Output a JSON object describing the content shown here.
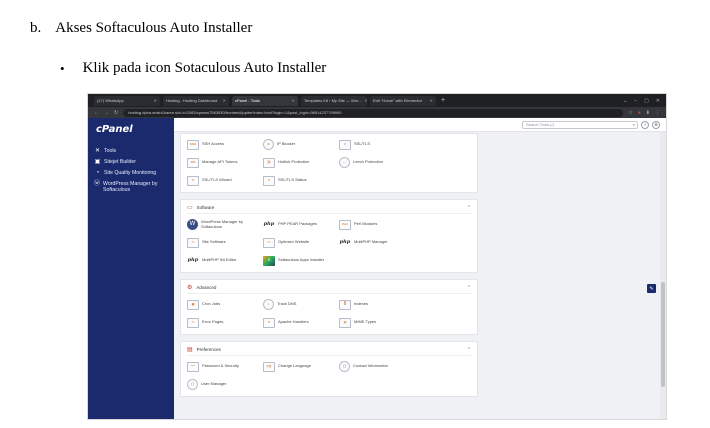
{
  "doc": {
    "heading_marker": "b.",
    "heading_text": "Akses Softaculous Auto Installer",
    "bullet_symbol": "•",
    "bullet_text": "Klik pada icon Sotaculous Auto Installer"
  },
  "browser": {
    "tabs": [
      {
        "label": "(17) WhatsApp",
        "active": false
      },
      {
        "label": "Hosting - Hosting Dashboard",
        "active": false
      },
      {
        "label": "cPanel - Tools",
        "active": true
      },
      {
        "label": "Templates Kit › My Site — Wor…",
        "active": false
      },
      {
        "label": "Edit \"Home\" with Elementor",
        "active": false
      }
    ],
    "new_tab": "+",
    "url": "hosting.dpha.smkn1karen.sch.id:2083/cpsess7563930/frontend/jupiter/index.html?login=1&post_login=98914237799990",
    "window_controls": [
      "⌄",
      "–",
      "▢",
      "✕"
    ],
    "addr_icons": [
      "☆",
      "●",
      "⬇",
      "⋮"
    ]
  },
  "cpanel": {
    "logo": "cPanel",
    "nav": [
      {
        "icon": "✕",
        "icon_name": "tools-icon",
        "label": "Tools"
      },
      {
        "icon": "▣",
        "icon_name": "sitejet-icon",
        "label": "Sitejet Builder"
      },
      {
        "icon": "◔",
        "icon_name": "monitor-icon",
        "label": "Site Quality Monitoring"
      },
      {
        "icon": "ⓦ",
        "icon_name": "wordpress-icon",
        "label": "WordPress Manager by Softaculous"
      }
    ],
    "search_placeholder": "Search Tools (/)",
    "top_icons": [
      "?",
      "⚙"
    ],
    "sections": [
      {
        "title": "",
        "collapsible": false,
        "items": [
          {
            "label": "SSH Access",
            "icon": "SSH"
          },
          {
            "label": "IP Blocker",
            "icon": "⊘"
          },
          {
            "label": "SSL/TLS",
            "icon": "≡"
          },
          {
            "label": "Manage API Tokens",
            "icon": "API"
          },
          {
            "label": "Hotlink Protection",
            "icon": "⛓"
          },
          {
            "label": "Leech Protection",
            "icon": "⋯"
          },
          {
            "label": "SSL/TLS Wizard",
            "icon": "≡"
          },
          {
            "label": "SSL/TLS Status",
            "icon": "≡"
          }
        ]
      },
      {
        "title": "Software",
        "collapsible": true,
        "items": [
          {
            "label": "WordPress Manager by Softaculous",
            "icon": "W"
          },
          {
            "label": "PHP PEAR Packages",
            "icon": "php"
          },
          {
            "label": "Perl Modules",
            "icon": "Perl"
          },
          {
            "label": "Site Software",
            "icon": "▭"
          },
          {
            "label": "Optimize Website",
            "icon": "▭"
          },
          {
            "label": "MultiPHP Manager",
            "icon": "php"
          },
          {
            "label": "MultiPHP INI Editor",
            "icon": "php"
          },
          {
            "label": "Softaculous Apps Installer",
            "icon": "S"
          }
        ]
      },
      {
        "title": "Advanced",
        "collapsible": true,
        "items": [
          {
            "label": "Cron Jobs",
            "icon": "▦"
          },
          {
            "label": "Track DNS",
            "icon": "⌖"
          },
          {
            "label": "Indexes",
            "icon": "≣"
          },
          {
            "label": "Error Pages",
            "icon": "▭"
          },
          {
            "label": "Apache Handlers",
            "icon": "✎"
          },
          {
            "label": "MIME Types",
            "icon": "▤"
          }
        ]
      },
      {
        "title": "Preferences",
        "collapsible": true,
        "items": [
          {
            "label": "Password & Security",
            "icon": "***"
          },
          {
            "label": "Change Language",
            "icon": "A文"
          },
          {
            "label": "Contact Information",
            "icon": "◯"
          },
          {
            "label": "User Manager",
            "icon": "◯"
          }
        ]
      }
    ],
    "chevron": "⌃"
  }
}
